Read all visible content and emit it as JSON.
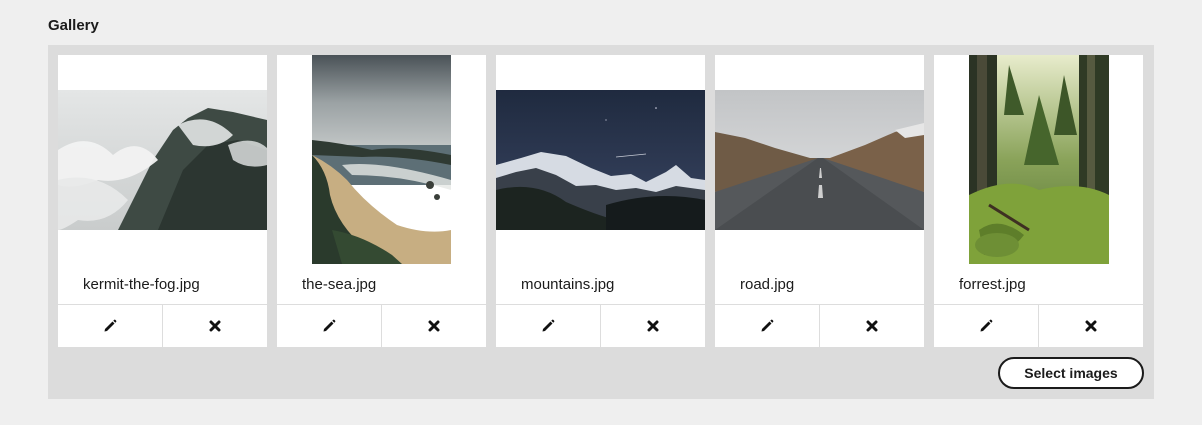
{
  "gallery": {
    "title": "Gallery",
    "select_button_label": "Select images",
    "images": [
      {
        "filename": "kermit-the-fog.jpg",
        "subject": "foggy-mountain",
        "orientation": "landscape"
      },
      {
        "filename": "the-sea.jpg",
        "subject": "sea-coast",
        "orientation": "portrait"
      },
      {
        "filename": "mountains.jpg",
        "subject": "snowy-mountains-night",
        "orientation": "landscape"
      },
      {
        "filename": "road.jpg",
        "subject": "road-through-valley",
        "orientation": "landscape"
      },
      {
        "filename": "forrest.jpg",
        "subject": "forest",
        "orientation": "portrait"
      }
    ],
    "actions": {
      "edit_icon": "pencil-icon",
      "remove_icon": "close-icon"
    }
  },
  "colors": {
    "page_background": "#efefef",
    "panel_background": "#dcdcdc",
    "card_background": "#ffffff",
    "text": "#1b1b1b"
  }
}
